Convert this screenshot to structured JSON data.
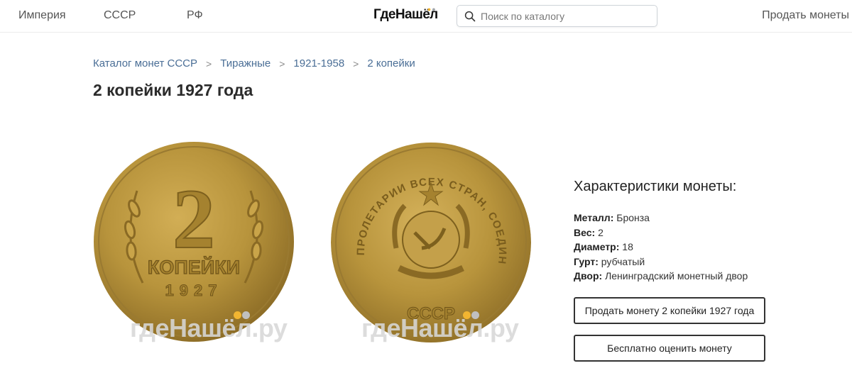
{
  "header": {
    "nav": [
      "Империя",
      "СССР",
      "РФ"
    ],
    "logo_main": "ГдеНаш",
    "logo_accent": "ёл",
    "search_placeholder": "Поиск по каталогу",
    "sell_label": "Продать монеты"
  },
  "breadcrumb": [
    "Каталог монет СССР",
    "Тиражные",
    "1921-1958",
    "2 копейки"
  ],
  "breadcrumb_separator": ">",
  "title": "2 копейки 1927 года",
  "coin": {
    "obverse_denomination": "2",
    "obverse_text": "КОПЕЙКИ",
    "obverse_year": "1927",
    "reverse_legend": "ПРОЛЕТАРИИ ВСЕХ СТРАН, СОЕДИНЯЙТЕСЬ!",
    "reverse_emblem_text": "СССР"
  },
  "watermark": "гдеНашёл.ру",
  "specs": {
    "title": "Характеристики монеты:",
    "rows": [
      {
        "label": "Металл:",
        "value": "Бронза"
      },
      {
        "label": "Вес:",
        "value": "2"
      },
      {
        "label": "Диаметр:",
        "value": "18"
      },
      {
        "label": "Гурт:",
        "value": "рубчатый"
      },
      {
        "label": "Двор:",
        "value": "Ленинградский монетный двор"
      }
    ]
  },
  "buttons": {
    "sell_coin": "Продать монету 2 копейки 1927 года",
    "evaluate": "Бесплатно оценить монету"
  },
  "colors": {
    "link": "#4a6e96",
    "coin_bronze": "#b8943c",
    "accent_dot": "#f2b531"
  },
  "icons": {
    "search": "magnifier-icon"
  }
}
